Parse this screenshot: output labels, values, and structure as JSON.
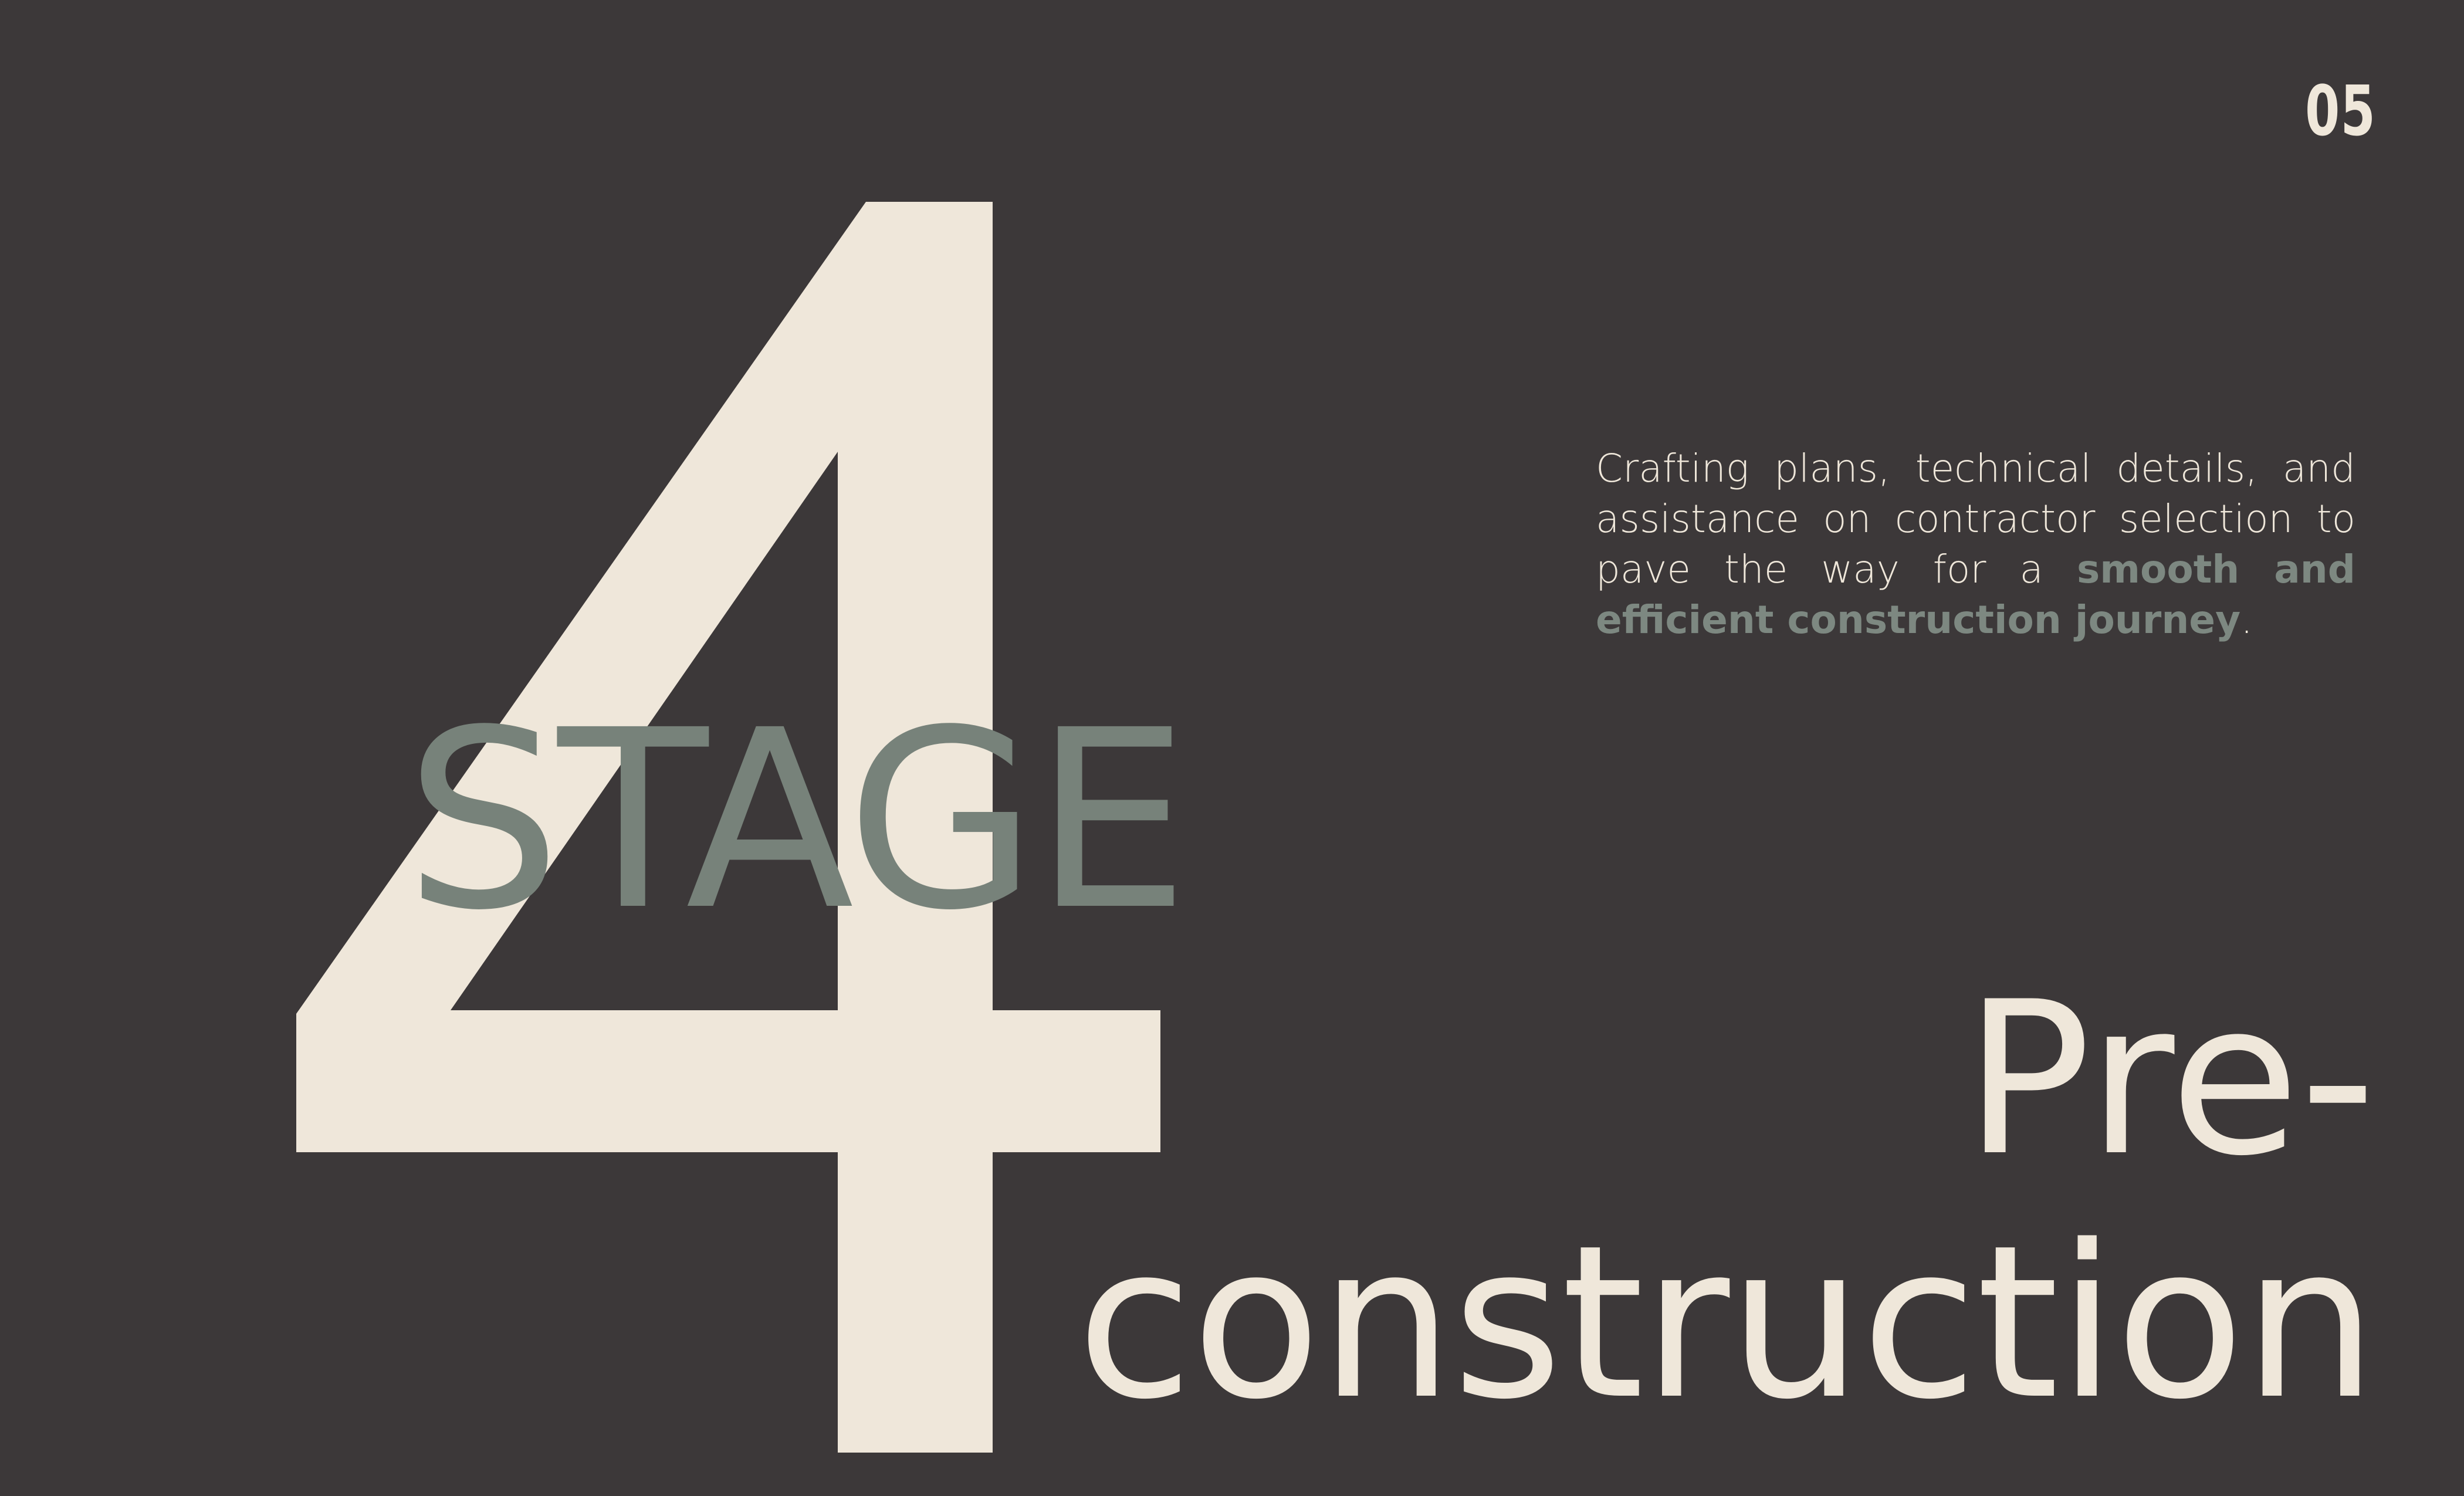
{
  "page": {
    "number": "05"
  },
  "stage": {
    "numeral": "4",
    "label": "STAGE"
  },
  "intro": {
    "text_plain": "Crafting plans, technical details, and assistance on contractor selection to pave the way for a ",
    "text_emphasis": "smooth and efficient construction journey",
    "text_end": "."
  },
  "title": {
    "line1": "Pre-",
    "line2": "construction"
  },
  "colors": {
    "background": "#3c3839",
    "cream": "#efe7da",
    "sage": "#77827a"
  }
}
